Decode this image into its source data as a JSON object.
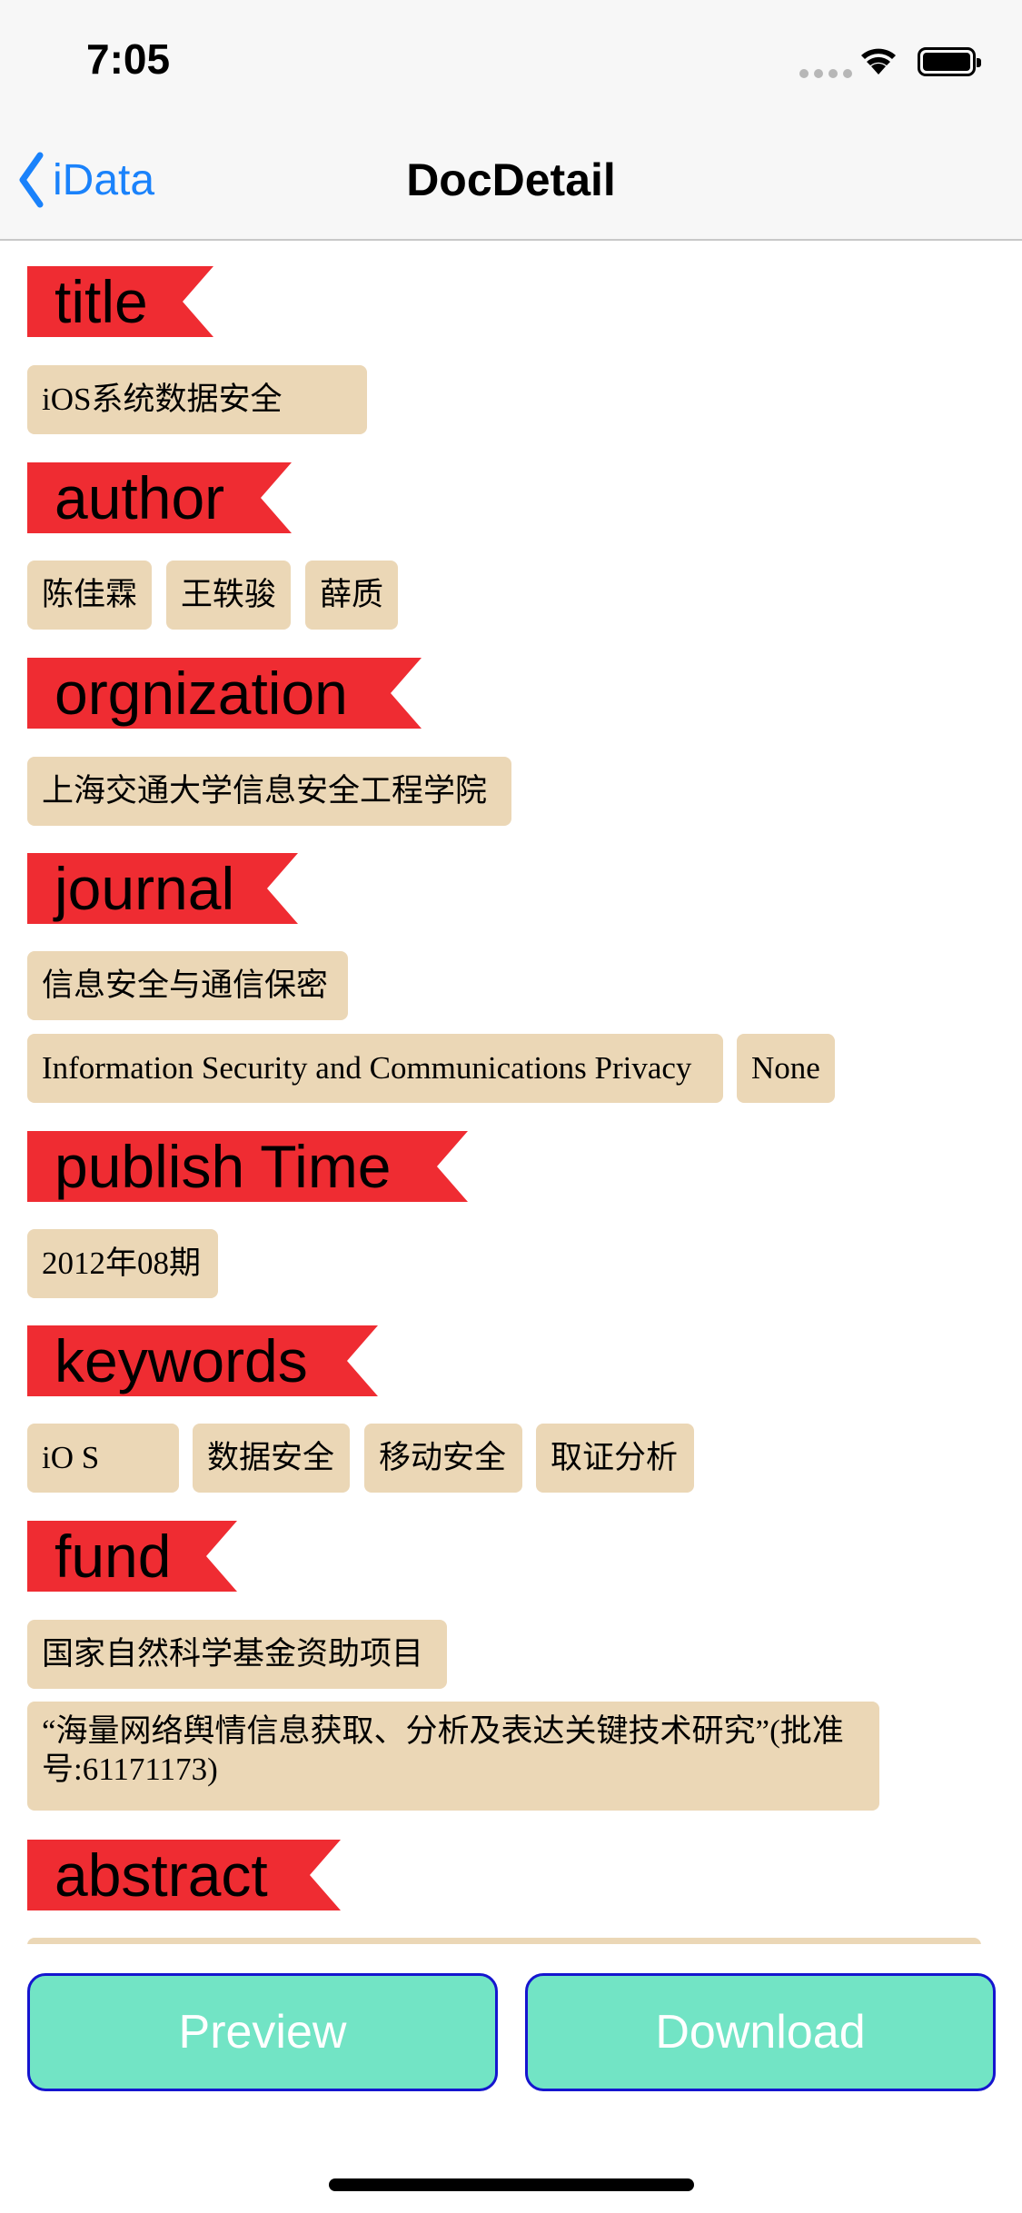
{
  "status_bar": {
    "time": "7:05"
  },
  "nav": {
    "back_label": "iData",
    "title": "DocDetail"
  },
  "sections": {
    "title": {
      "heading": "title",
      "values": [
        "iOS系统数据安全"
      ]
    },
    "author": {
      "heading": "author",
      "values": [
        "陈佳霖",
        "王轶骏",
        "薛质"
      ]
    },
    "organization": {
      "heading": "orgnization",
      "values": [
        "上海交通大学信息安全工程学院"
      ]
    },
    "journal": {
      "heading": "journal",
      "values": [
        "信息安全与通信保密",
        "Information Security and Communications Privacy",
        "None"
      ]
    },
    "publish_time": {
      "heading": "publish Time",
      "values": [
        "2012年08期"
      ]
    },
    "keywords": {
      "heading": "keywords",
      "values": [
        "iO S",
        "数据安全",
        "移动安全",
        "取证分析"
      ]
    },
    "fund": {
      "heading": "fund",
      "values": [
        "国家自然科学基金资助项目",
        "“海量网络舆情信息获取、分析及表达关键技术研究”(批准号:61171173)"
      ]
    },
    "abstract": {
      "heading": "abstract"
    }
  },
  "actions": {
    "preview_label": "Preview",
    "download_label": "Download"
  },
  "colors": {
    "ribbon": "#ef2c32",
    "chip": "#ebd7b6",
    "button_fill": "#72e4c5",
    "button_border": "#1515cf",
    "link": "#1a82fb"
  }
}
